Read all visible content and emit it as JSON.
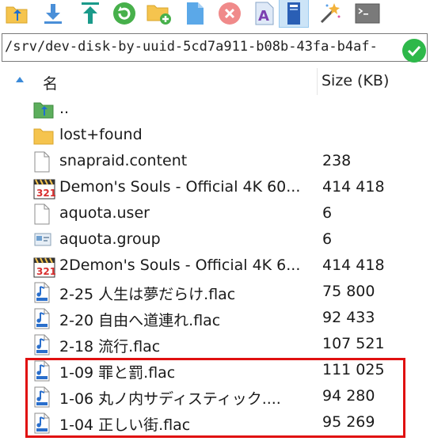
{
  "toolbar": {
    "buttons": [
      {
        "id": "parent-dir",
        "icon": "parent-folder-icon"
      },
      {
        "id": "download",
        "icon": "download-arrow-icon"
      },
      {
        "id": "upload",
        "icon": "upload-arrow-icon"
      },
      {
        "id": "refresh",
        "icon": "refresh-icon"
      },
      {
        "id": "new-folder",
        "icon": "new-folder-icon"
      },
      {
        "id": "new-file",
        "icon": "new-file-icon"
      },
      {
        "id": "delete",
        "icon": "delete-icon"
      },
      {
        "id": "rename",
        "icon": "rename-icon"
      },
      {
        "id": "properties",
        "icon": "properties-icon"
      },
      {
        "id": "wizard",
        "icon": "magic-wand-icon"
      },
      {
        "id": "terminal",
        "icon": "terminal-icon"
      }
    ]
  },
  "path": {
    "value": "/srv/dev-disk-by-uuid-5cd7a911-b08b-43fa-b4af-"
  },
  "columns": {
    "name": "名",
    "size": "Size (KB)"
  },
  "files": [
    {
      "name": "..",
      "size": "",
      "icon": "parent-folder-icon"
    },
    {
      "name": "lost+found",
      "size": "",
      "icon": "folder-icon"
    },
    {
      "name": "snapraid.content",
      "size": "238",
      "icon": "file-icon"
    },
    {
      "name": "Demon's Souls - Official 4K 60...",
      "size": "414 418",
      "icon": "video-file-icon"
    },
    {
      "name": "aquota.user",
      "size": "6",
      "icon": "file-icon"
    },
    {
      "name": "aquota.group",
      "size": "6",
      "icon": "system-file-icon"
    },
    {
      "name": "2Demon's Souls - Official 4K 6...",
      "size": "414 418",
      "icon": "video-file-icon"
    },
    {
      "name": "2-25 人生は夢だらけ.flac",
      "size": "75 800",
      "icon": "audio-file-icon"
    },
    {
      "name": "2-20 自由へ道連れ.flac",
      "size": "92 433",
      "icon": "audio-file-icon"
    },
    {
      "name": "2-18 流行.flac",
      "size": "107 521",
      "icon": "audio-file-icon"
    },
    {
      "name": "1-09 罪と罰.flac",
      "size": "111 025",
      "icon": "audio-file-icon"
    },
    {
      "name": "1-06 丸ノ内サディスティック....",
      "size": "94 280",
      "icon": "audio-file-icon"
    },
    {
      "name": "1-04 正しい街.flac",
      "size": "95 269",
      "icon": "audio-file-icon"
    }
  ],
  "colors": {
    "highlight": "#e01010",
    "folder": "#f5c44e",
    "ok": "#2eb84a"
  }
}
